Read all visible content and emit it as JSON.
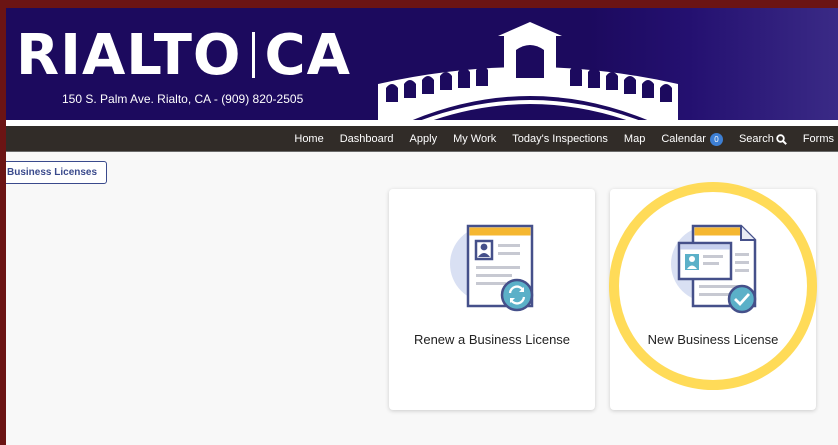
{
  "banner": {
    "logo_left": "RIALTO",
    "logo_right": "CA",
    "address": "150 S. Palm Ave. Rialto, CA - (909) 820-2505"
  },
  "nav": {
    "items": [
      "Home",
      "Dashboard",
      "Apply",
      "My Work",
      "Today's Inspections",
      "Map"
    ],
    "calendar_label": "Calendar",
    "calendar_count": "0",
    "search_label": "Search",
    "forms_label": "Forms"
  },
  "breadcrumb_button": "Business Licenses",
  "cards": {
    "renew": "Renew a Business License",
    "new": "New Business License"
  },
  "colors": {
    "banner": "#1c0a5e",
    "navbar": "#312c28",
    "highlight": "#ffd84a",
    "icon_accent": "#5bb0c8"
  }
}
